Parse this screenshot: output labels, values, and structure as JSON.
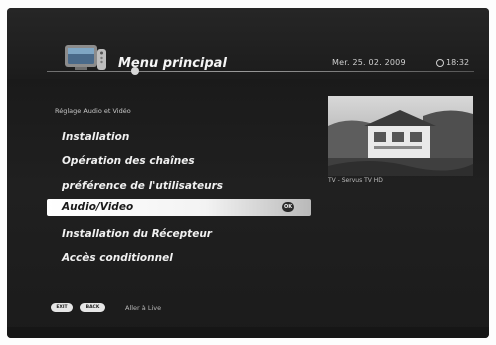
{
  "header": {
    "title": "Menu principal",
    "date": "Mer. 25. 02. 2009",
    "time": "18:32"
  },
  "section_label": "Réglage Audio et Vidéo",
  "menu": {
    "items": [
      {
        "label": "Installation",
        "selected": false
      },
      {
        "label": "Opération des chaînes",
        "selected": false
      },
      {
        "label": "préférence de l'utilisateurs",
        "selected": false
      },
      {
        "label": "Audio/Video",
        "selected": true
      },
      {
        "label": "Installation du Récepteur",
        "selected": false
      },
      {
        "label": "Accès conditionnel",
        "selected": false
      }
    ],
    "ok_label": "OK"
  },
  "preview": {
    "caption": "TV - Servus TV HD"
  },
  "footer": {
    "exit_label": "EXIT",
    "back_label": "BACK",
    "hint": "Aller à Live"
  },
  "icons": {
    "logo": "tv-remote-logo-icon",
    "clock": "clock-icon"
  },
  "colors": {
    "background": "#1e1e1e",
    "highlight": "#ffffff",
    "text": "#f0f0f0"
  }
}
